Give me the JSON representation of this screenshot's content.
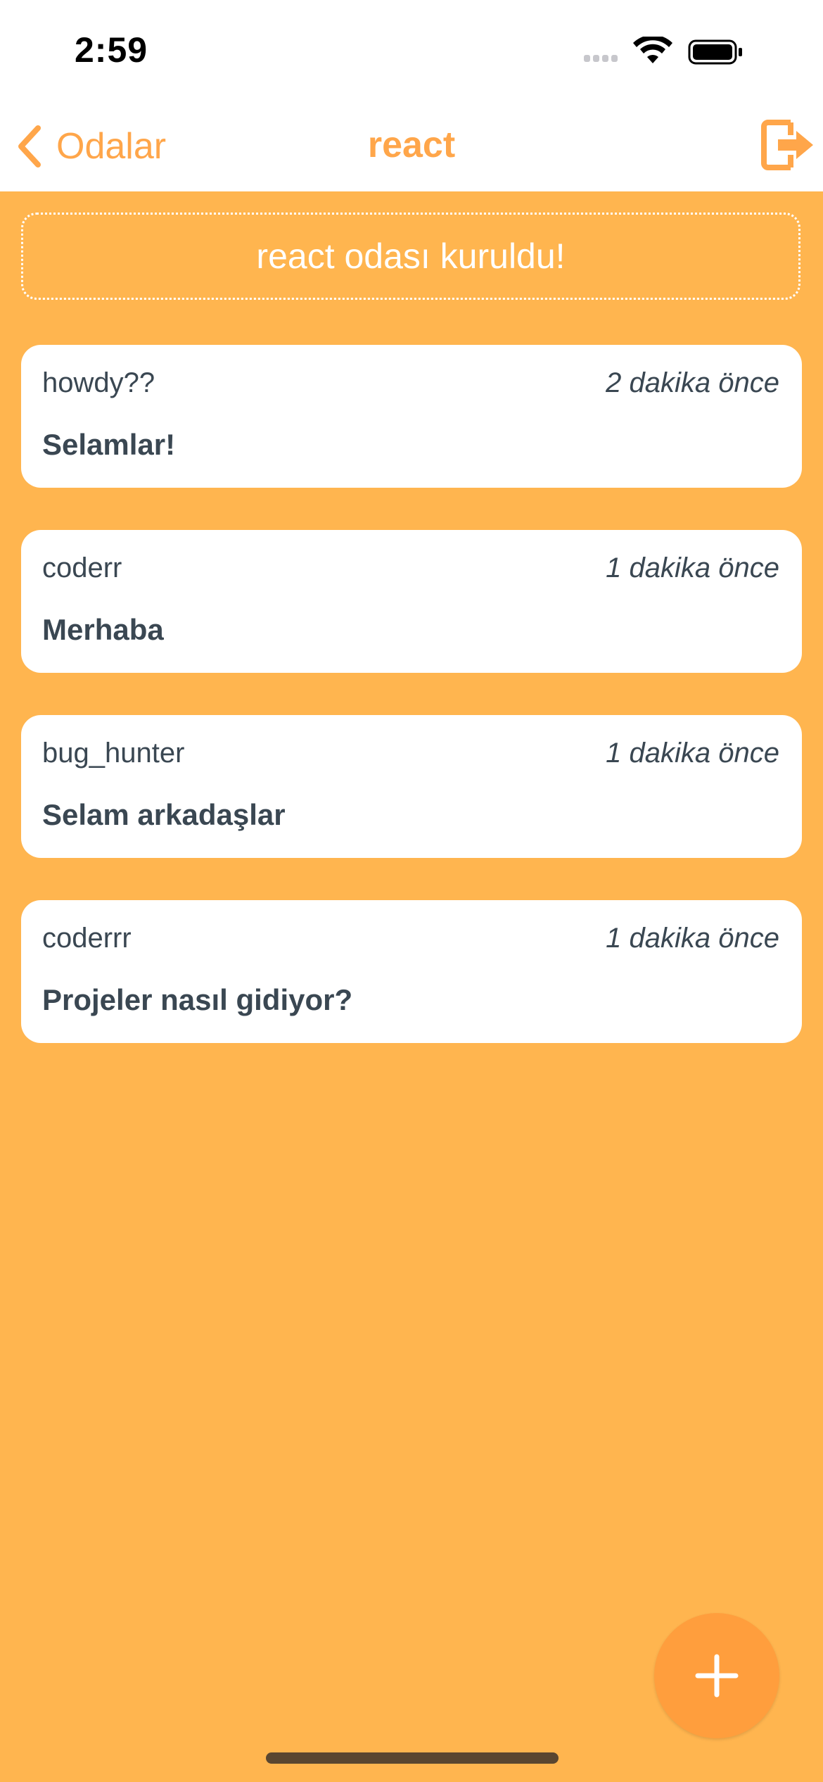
{
  "status_bar": {
    "time": "2:59",
    "icons": [
      "signal-icon",
      "wifi-icon",
      "battery-icon"
    ]
  },
  "nav": {
    "back_label": "Odalar",
    "title": "react",
    "exit_icon": "logout-icon"
  },
  "banner": {
    "text": "react odası kuruldu!"
  },
  "messages": [
    {
      "user": "howdy??",
      "time": "2 dakika önce",
      "text": "Selamlar!"
    },
    {
      "user": "coderr",
      "time": "1 dakika önce",
      "text": "Merhaba"
    },
    {
      "user": "bug_hunter",
      "time": "1 dakika önce",
      "text": "Selam arkadaşlar"
    },
    {
      "user": "coderrr",
      "time": "1 dakika önce",
      "text": "Projeler nasıl gidiyor?"
    }
  ],
  "fab": {
    "icon": "plus-icon"
  },
  "colors": {
    "background": "#FFB54F",
    "accent": "#FFA64A",
    "fab": "#FF9E3D",
    "card": "#FFFFFF",
    "text": "#3A4752"
  }
}
